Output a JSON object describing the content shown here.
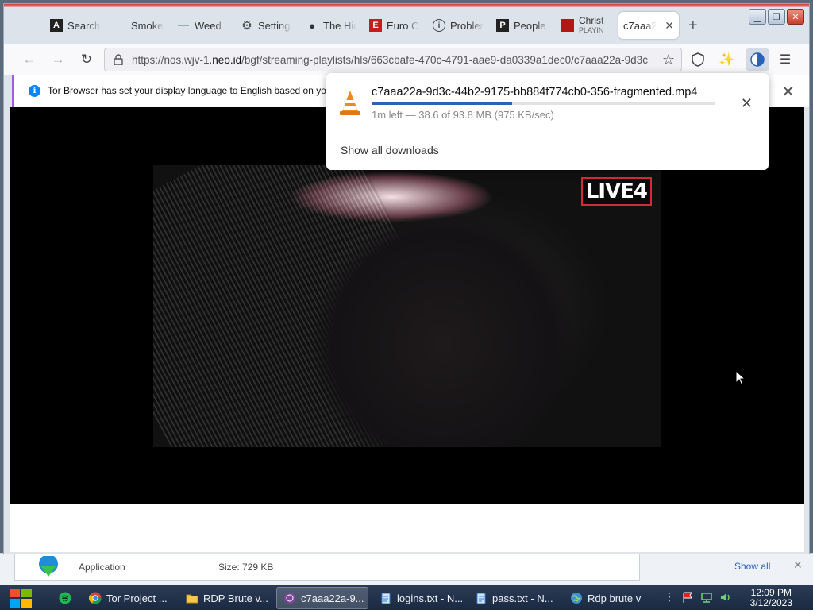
{
  "desktop": {
    "app_type": "Application",
    "app_size": "Size: 729 KB",
    "show_all": "Show all"
  },
  "tabs": [
    {
      "label": "Search",
      "icon": "a-icon"
    },
    {
      "label": "Smoke",
      "icon": "blank-icon"
    },
    {
      "label": "Weed",
      "icon": "dash-icon"
    },
    {
      "label": "Settings",
      "icon": "gear-icon"
    },
    {
      "label": "The Hidden",
      "icon": "bomb-icon"
    },
    {
      "label": "Euro C",
      "icon": "flag-icon"
    },
    {
      "label": "Problem",
      "icon": "info-icon"
    },
    {
      "label": "People",
      "icon": "p-icon"
    },
    {
      "label": "Christ",
      "sublabel": "PLAYIN",
      "icon": "red-icon"
    },
    {
      "label": "c7aaa2",
      "icon": "blank-icon",
      "active": true
    }
  ],
  "nav": {
    "url_prefix": "https://nos.wjv-1.",
    "url_domain": "neo.id",
    "url_rest": "/bgf/streaming-playlists/hls/663cbafe-470c-4791-aae9-da0339a1dec0/c7aaa22a-9d3c"
  },
  "notification": {
    "message": "Tor Browser has set your display language to English based on your"
  },
  "video": {
    "badge": "LIVE4"
  },
  "download": {
    "filename": "c7aaa22a-9d3c-44b2-9175-bb884f774cb0-356-fragmented.mp4",
    "status": "1m left — 38.6 of 93.8 MB (975 KB/sec)",
    "progress": 0.41,
    "show_all": "Show all downloads"
  },
  "taskbar": {
    "items": [
      {
        "label": "Tor Project ...",
        "icon": "chrome-icon"
      },
      {
        "label": "RDP Brute v...",
        "icon": "folder-icon"
      },
      {
        "label": "c7aaa22a-9...",
        "icon": "tor-icon",
        "active": true
      },
      {
        "label": "logins.txt - N...",
        "icon": "notepad-icon"
      },
      {
        "label": "pass.txt - N...",
        "icon": "notepad-icon"
      },
      {
        "label": "Rdp brute v",
        "icon": "globe-icon"
      }
    ],
    "time": "12:09 PM",
    "date": "3/12/2023"
  }
}
